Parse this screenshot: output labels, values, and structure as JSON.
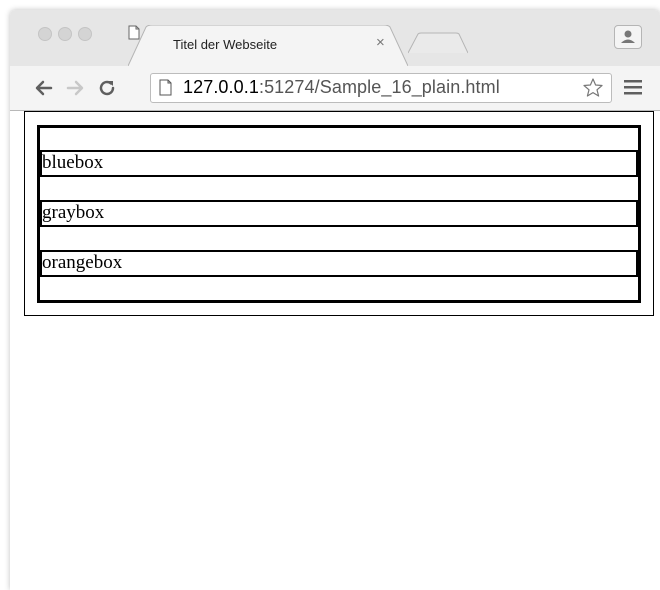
{
  "browser": {
    "tab": {
      "title": "Titel der Webseite",
      "close_label": "×"
    },
    "address_bar": {
      "host": "127.0.0.1",
      "rest": ":51274/Sample_16_plain.html"
    }
  },
  "page": {
    "boxes": [
      {
        "label": "bluebox"
      },
      {
        "label": "graybox"
      },
      {
        "label": "orangebox"
      }
    ]
  },
  "icons": [
    "back-arrow-icon",
    "forward-arrow-icon",
    "reload-icon",
    "page-icon",
    "star-icon",
    "menu-icon",
    "profile-icon"
  ]
}
